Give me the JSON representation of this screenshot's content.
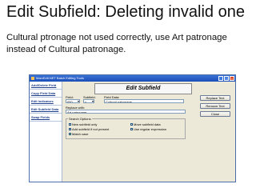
{
  "slide": {
    "title": "Edit Subfield: Deleting invalid one",
    "body": "Cultural ptronage not used correctly, use Art patronage instead of Cultural patronage."
  },
  "window": {
    "title": "MarcEdit.NET Batch Editing Tools",
    "nav_items": [
      "Add/Delete Field",
      "Copy Field Data",
      "Edit Indicators",
      "Edit Subfield Data",
      "Swap Fields"
    ],
    "heading": "Edit Subfield",
    "field_label": "Field:",
    "subfield_label": "Subfield:",
    "field_data_label": "Field Data:",
    "field_value": "650",
    "subfield_value": "x",
    "field_data_value": "Cultural patronage",
    "replace_with_label": "Replace with:",
    "replace_with_value": "Art patronage",
    "buttons": {
      "replace": "Replace Text",
      "remove": "Remove Text",
      "close": "Close"
    },
    "search_options": {
      "legend": "Search Options",
      "new_subfield": "New subfield only",
      "add_if_not_present": "Add subfield if not present",
      "match_case": "Match case",
      "move_subfield": "Move subfield data",
      "use_regex": "Use regular expression",
      "checked": [
        "match_case"
      ]
    }
  }
}
